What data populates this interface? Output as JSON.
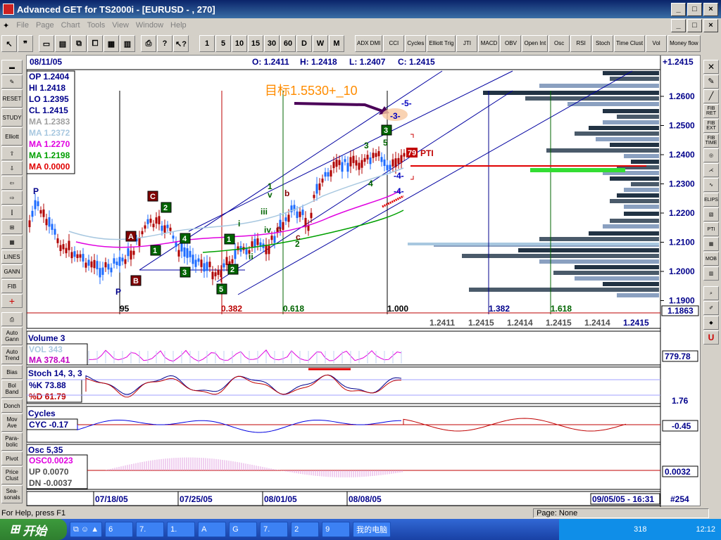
{
  "window": {
    "title": "Advanced GET for TS2000i - [EURUSD - , 270]",
    "min": "_",
    "max": "□",
    "close": "×",
    "min2": "_",
    "max2": "□",
    "close2": "×"
  },
  "menu": [
    "File",
    "Page",
    "Chart",
    "Tools",
    "View",
    "Window",
    "Help"
  ],
  "toolbar": {
    "intervals": [
      "1",
      "5",
      "10",
      "15",
      "30",
      "60",
      "D",
      "W",
      "M"
    ],
    "studies": [
      "ADX DMI",
      "CCI",
      "Cycles",
      "Elliott Trig",
      "JTI",
      "MACD",
      "OBV",
      "Open Int",
      "Osc",
      "RSI",
      "Stoch",
      "Time Clust",
      "Vol",
      "Money flow"
    ]
  },
  "left_toolbar": [
    "RESET",
    "STUDY",
    "Elliott",
    "LINES",
    "GANN",
    "FIB",
    "Auto Gann",
    "Auto Trend",
    "Bias",
    "Bol Band",
    "Donch",
    "Mov Ave",
    "Para-bolic",
    "Pivot",
    "Price Clust",
    "Sea-sonals"
  ],
  "right_toolbar": [
    "FIB RET",
    "FIB EXT",
    "FIB TIME",
    "PTI",
    "MOB",
    "ELIPS"
  ],
  "header": {
    "date": "08/11/05",
    "open": "O: 1.2411",
    "high": "H: 1.2418",
    "low": "L: 1.2407",
    "close": "C: 1.2415",
    "change": "+1.2415"
  },
  "legend": {
    "op": "OP 1.2404",
    "hi": "HI  1.2418",
    "lo": "LO  1.2395",
    "cl": "CL  1.2415",
    "ma1": "MA 1.2383",
    "ma2": "MA 1.2372",
    "ma3": "MA 1.2270",
    "ma4": "MA 1.2198",
    "ma5": "MA 0.0000"
  },
  "annotation": {
    "target": "目标1.5530+_10"
  },
  "price_axis": [
    "1.2600",
    "1.2500",
    "1.2400",
    "1.2300",
    "1.2200",
    "1.2100",
    "1.2000",
    "1.1900"
  ],
  "current_price": "1.1863",
  "fib_labels": [
    "95",
    "0.382",
    "0.618",
    "1.000",
    "1.382",
    "1.618"
  ],
  "bottom_values": [
    "1.2411",
    "1.2415",
    "1.2414",
    "1.2415",
    "1.2414",
    "1.2415"
  ],
  "pti": {
    "value": "79",
    "label": "PTI"
  },
  "elliott": [
    "P",
    "P",
    "A",
    "B",
    "C",
    "1",
    "2",
    "3",
    "4",
    "5",
    "1",
    "2",
    "3",
    "4",
    "5",
    "i",
    "ii",
    "iii",
    "iv",
    "v",
    "a",
    "b",
    "c",
    "1",
    "v",
    "2",
    "3",
    "4",
    "5",
    "3",
    "4",
    "-5-",
    "-3-",
    "-4-",
    "-4-"
  ],
  "volume": {
    "title": "Volume 3",
    "vol": "VOL 343",
    "ma": "MA  378.41",
    "value": "779.78"
  },
  "stoch": {
    "title": "Stoch 14, 3, 3",
    "k": "%K  73.88",
    "d": "%D  61.79",
    "value": "1.76"
  },
  "cycles": {
    "title": "Cycles",
    "cyc": "CYC -0.17",
    "value": "-0.45"
  },
  "osc": {
    "title": "Osc 5,35",
    "osc": "OSC0.0023",
    "up": "UP   0.0070",
    "dn": "DN   -0.0037",
    "value": "0.0032"
  },
  "time_axis": [
    "07/18/05",
    "07/25/05",
    "08/01/05",
    "08/08/05"
  ],
  "time_stamp": "09/05/05 - 16:31",
  "bar_count": "#254",
  "status": {
    "help": "For Help, press F1",
    "page": "Page: None"
  },
  "taskbar": {
    "start": "开始",
    "tasks": [
      "6",
      "7.",
      "1.",
      "A",
      "G",
      "7.",
      "2",
      "9",
      "我的电脑"
    ],
    "clock": "12:12",
    "tray_num": "318"
  },
  "colors": {
    "up": "#1c6bff",
    "down": "#b00000",
    "green": "#006400",
    "fib_red": "#cc0000"
  }
}
